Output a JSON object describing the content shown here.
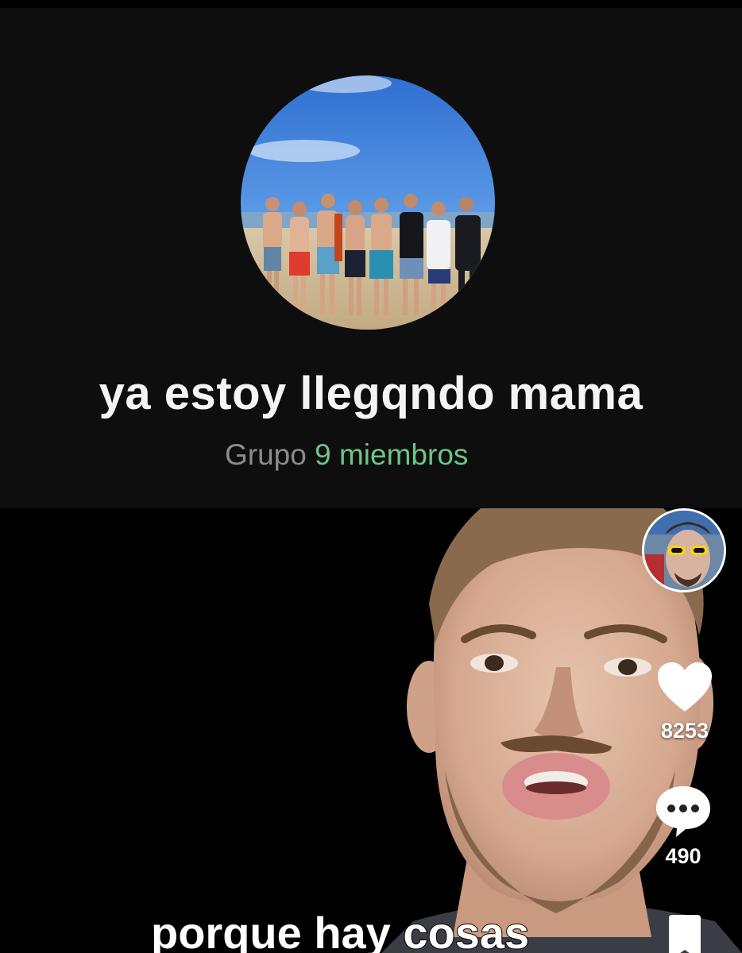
{
  "group": {
    "title": "ya estoy llegqndo mama",
    "type_label": "Grupo",
    "members_label": "9 miembros",
    "members_color": "#6fc488"
  },
  "rail": {
    "likes": "8253",
    "comments": "490",
    "like_icon": "heart-icon",
    "comment_icon": "comment-bubble-icon",
    "bookmark_icon": "bookmark-icon"
  },
  "caption": {
    "text": "porque hay cosas"
  }
}
